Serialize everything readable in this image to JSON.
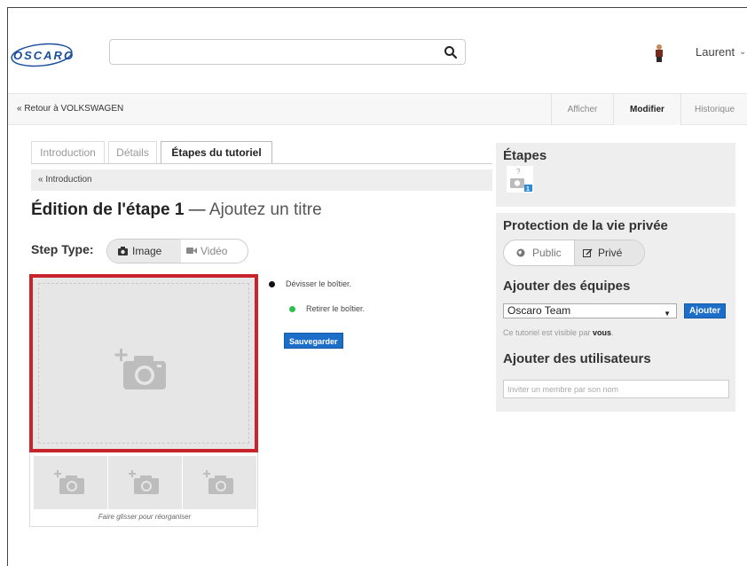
{
  "header": {
    "logo_text": "OSCARO",
    "search": {
      "value": "",
      "placeholder": ""
    },
    "user_name": "Laurent",
    "user_chevron": "⌄"
  },
  "breadcrumb": {
    "back_label": "« Retour à VOLKSWAGEN",
    "view_tabs": [
      "Afficher",
      "Modifier",
      "Historique"
    ],
    "active_view": "Modifier"
  },
  "editor": {
    "tabs": [
      "Introduction",
      "Détails",
      "Étapes du tutoriel"
    ],
    "active_tab": "Étapes du tutoriel",
    "sub_crumb": "« Introduction",
    "title_prefix": "Édition de l'étape 1",
    "title_dash": " — ",
    "title_placeholder": "Ajoutez un titre",
    "step_type_label": "Step Type:",
    "step_type_options": [
      "Image",
      "Vidéo"
    ],
    "step_type_selected": "Image",
    "drag_hint": "Faire glisser pour réorganiser",
    "bullets": [
      {
        "text": "Dévisser le boîtier.",
        "color": "#111111"
      },
      {
        "text": "Retirer le boîtier.",
        "color": "#2fbf4f"
      }
    ],
    "save_label": "Sauvegarder"
  },
  "sidebar": {
    "steps_title": "Étapes",
    "step_thumb_number": "1",
    "privacy_title": "Protection de la vie privée",
    "privacy_options": [
      "Public",
      "Privé"
    ],
    "privacy_selected": "Privé",
    "teams_title": "Ajouter des équipes",
    "team_selected": "Oscaro Team",
    "add_label": "Ajouter",
    "visible_prefix": "Ce tutoriel est visible par ",
    "visible_bold": "vous",
    "visible_suffix": ".",
    "users_title": "Ajouter des utilisateurs",
    "invite_placeholder": "Inviter un membre par son nom"
  },
  "colors": {
    "accent_blue": "#1d6ec9",
    "highlight_red": "#c9242b",
    "logo_blue": "#1a4f9c",
    "panel_gray": "#eeeeee"
  },
  "icons": [
    "search-icon",
    "user-avatar-icon",
    "camera-icon",
    "video-camera-icon",
    "globe-icon",
    "edit-icon",
    "add-photo-icon"
  ]
}
